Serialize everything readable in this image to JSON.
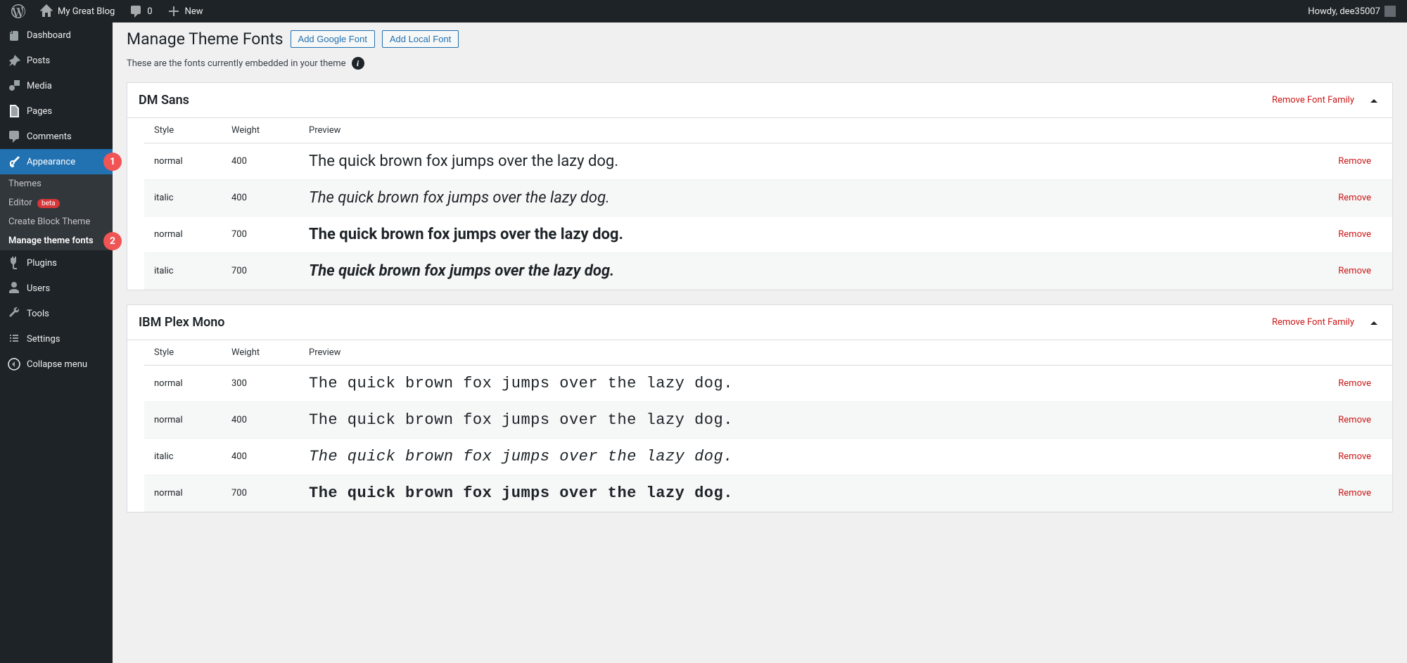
{
  "topbar": {
    "site_name": "My Great Blog",
    "comments_count": "0",
    "new_label": "New",
    "howdy": "Howdy, dee35007"
  },
  "sidebar": {
    "items": {
      "dashboard": "Dashboard",
      "posts": "Posts",
      "media": "Media",
      "pages": "Pages",
      "comments": "Comments",
      "appearance": "Appearance",
      "plugins": "Plugins",
      "users": "Users",
      "tools": "Tools",
      "settings": "Settings",
      "collapse": "Collapse menu"
    },
    "appearance_sub": {
      "themes": "Themes",
      "editor": "Editor",
      "editor_badge": "beta",
      "create_block": "Create Block Theme",
      "manage_fonts": "Manage theme fonts"
    },
    "badge1": "1",
    "badge2": "2"
  },
  "page": {
    "title": "Manage Theme Fonts",
    "add_google": "Add Google Font",
    "add_local": "Add Local Font",
    "subnote": "These are the fonts currently embedded in your theme"
  },
  "headers": {
    "style": "Style",
    "weight": "Weight",
    "preview": "Preview"
  },
  "actions": {
    "remove_family": "Remove Font Family",
    "remove": "Remove"
  },
  "preview_text": "The quick brown fox jumps over the lazy dog.",
  "fonts": [
    {
      "name": "DM Sans",
      "class": "sans",
      "variants": [
        {
          "style": "normal",
          "weight": "400"
        },
        {
          "style": "italic",
          "weight": "400"
        },
        {
          "style": "normal",
          "weight": "700"
        },
        {
          "style": "italic",
          "weight": "700"
        }
      ]
    },
    {
      "name": "IBM Plex Mono",
      "class": "mono",
      "variants": [
        {
          "style": "normal",
          "weight": "300"
        },
        {
          "style": "normal",
          "weight": "400"
        },
        {
          "style": "italic",
          "weight": "400"
        },
        {
          "style": "normal",
          "weight": "700"
        }
      ]
    }
  ]
}
